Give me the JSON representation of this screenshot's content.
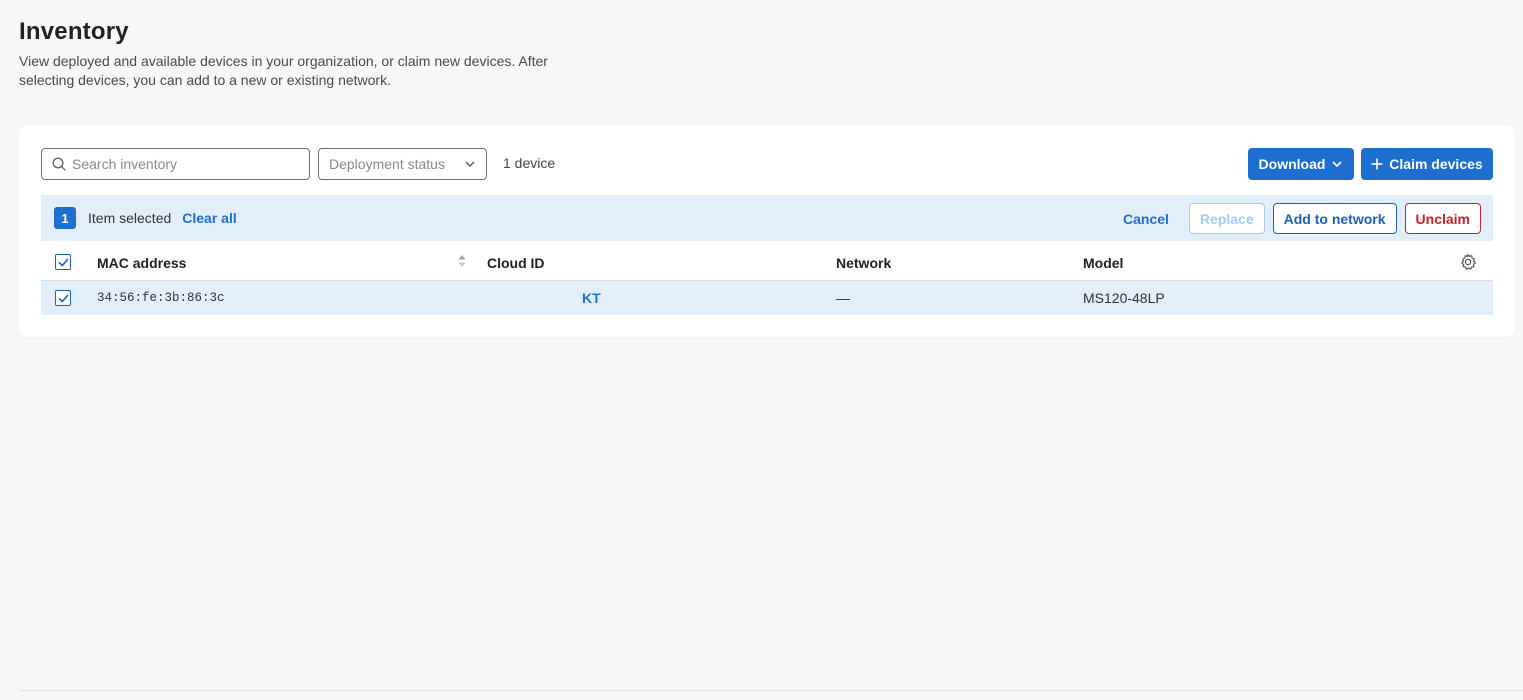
{
  "header": {
    "title": "Inventory",
    "description": "View deployed and available devices in your organization, or claim new devices. After selecting devices, you can add to a new or existing network."
  },
  "toolbar": {
    "search_placeholder": "Search inventory",
    "deployment_status_label": "Deployment status",
    "device_count": "1 device",
    "download_label": "Download",
    "claim_label": "Claim devices"
  },
  "selection": {
    "count": "1",
    "label": "Item selected",
    "clear_all": "Clear all",
    "cancel": "Cancel",
    "replace": "Replace",
    "add_to_network": "Add to network",
    "unclaim": "Unclaim"
  },
  "table": {
    "columns": {
      "mac": "MAC address",
      "cloud_id": "Cloud ID",
      "network": "Network",
      "model": "Model"
    },
    "rows": [
      {
        "selected": true,
        "mac": "34:56:fe:3b:86:3c",
        "cloud_id": "KT",
        "network": "—",
        "model": "MS120-48LP"
      }
    ]
  },
  "colors": {
    "primary": "#1f6fd1",
    "selection_bg": "#e3eefb",
    "danger": "#c8202f",
    "page_bg": "#f7f7f7"
  },
  "icons": {
    "search": "search-icon",
    "dropdown": "chevron-down-icon",
    "plus": "plus-icon",
    "sort": "sort-icon",
    "settings": "gear-icon",
    "checkbox": "checkmark-icon"
  }
}
